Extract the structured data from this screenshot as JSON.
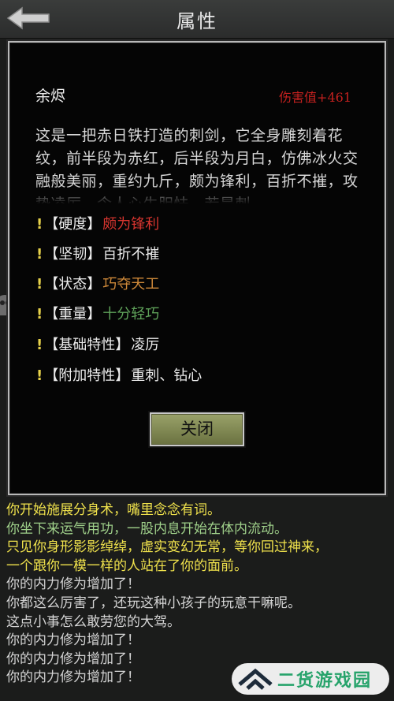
{
  "header": {
    "title": "属性"
  },
  "item": {
    "name": "余烬",
    "damage": "伤害值+461",
    "description": "这是一把赤日铁打造的刺剑，它全身雕刻着花纹，前半段为赤红，后半段为月白，仿佛冰火交融般美丽，重约九斤，颇为锋利，百折不摧，攻势凌厉，令人心生胆怯，若是刺"
  },
  "attributes": [
    {
      "marker": "!",
      "key": "【硬度】",
      "value": "颇为锋利",
      "color": "#d8352f"
    },
    {
      "marker": "!",
      "key": "【坚韧】",
      "value": "百折不摧",
      "color": "#ececec"
    },
    {
      "marker": "!",
      "key": "【状态】",
      "value": "巧夺天工",
      "color": "#d08a3a"
    },
    {
      "marker": "!",
      "key": "【重量】",
      "value": "十分轻巧",
      "color": "#5fa35a"
    },
    {
      "marker": "!",
      "key": "【基础特性】",
      "value": "凌厉",
      "color": "#ececec"
    },
    {
      "marker": "!",
      "key": "【附加特性】",
      "value": "重刺、钻心",
      "color": "#ececec"
    }
  ],
  "close_button": {
    "label": "关闭"
  },
  "log": [
    {
      "text": "你开始施展分身术，嘴里念念有词。",
      "color": "#f0e24c"
    },
    {
      "text": "你坐下来运气用功，一股内息开始在体内流动。",
      "color": "#9fd08a"
    },
    {
      "text": "只见你身形影影绰绰，虚实变幻无常，等你回过神来，",
      "color": "#f0e24c"
    },
    {
      "text": "一个跟你一模一样的人站在了你的面前。",
      "color": "#f0e24c"
    },
    {
      "text": "你的内力修为增加了！",
      "color": "#d4d4d4"
    },
    {
      "text": "你都这么厉害了，还玩这种小孩子的玩意干嘛呢。",
      "color": "#d4d4d4"
    },
    {
      "text": "这点小事怎么敢劳您的大驾。",
      "color": "#d4d4d4"
    },
    {
      "text": "你的内力修为增加了！",
      "color": "#d4d4d4"
    },
    {
      "text": "你的内力修为增加了！",
      "color": "#d4d4d4"
    },
    {
      "text": "你的内力修为增加了！",
      "color": "#d4d4d4"
    }
  ],
  "watermark": {
    "text": "二货游戏园",
    "icon": "house-logo-icon",
    "color": "#27a36b"
  }
}
